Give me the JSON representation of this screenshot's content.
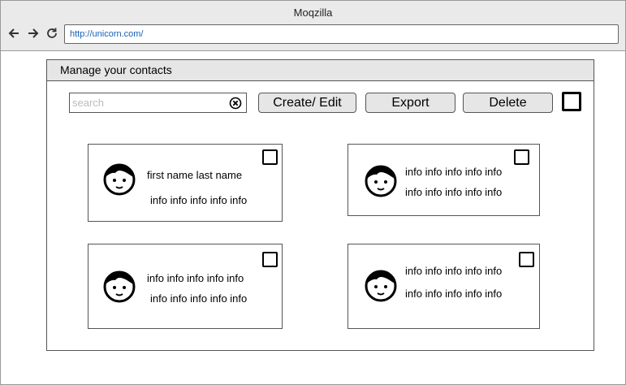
{
  "window": {
    "title": "Moqzilla",
    "url": "http://unicorn.com/"
  },
  "icons": {
    "back": "arrow-left-icon",
    "forward": "arrow-right-icon",
    "reload": "reload-icon",
    "clear": "clear-x-icon",
    "avatar": "person-face-icon"
  },
  "panel": {
    "title": "Manage your contacts"
  },
  "toolbar": {
    "search_placeholder": "search",
    "create_edit_label": "Create/ Edit",
    "export_label": "Export",
    "delete_label": "Delete"
  },
  "cards": [
    {
      "line1": "first name last name",
      "line2": "info info info info info"
    },
    {
      "line1": "info info info info info",
      "line2": "info info info info info"
    },
    {
      "line1": "info info info info info",
      "line2": "info info info info info"
    },
    {
      "line1": "info info info info info",
      "line2": "info info info info info"
    }
  ]
}
